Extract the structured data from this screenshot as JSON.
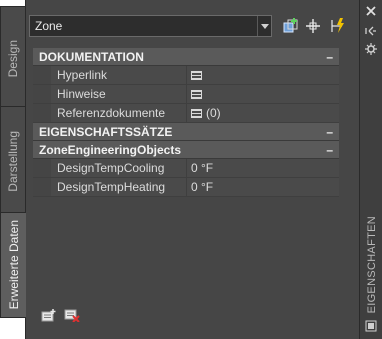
{
  "left_tabs": [
    "Design",
    "Darstellung",
    "Erweiterte Daten"
  ],
  "palette_title": "EIGENSCHAFTEN",
  "selector": {
    "value": "Zone"
  },
  "categories": [
    {
      "title": "DOKUMENTATION",
      "toggle": "–",
      "rows": [
        {
          "name": "Hyperlink",
          "value": ""
        },
        {
          "name": "Hinweise",
          "value": ""
        },
        {
          "name": "Referenzdokumente",
          "value": "(0)"
        }
      ]
    },
    {
      "title": "EIGENSCHAFTSSÄTZE",
      "toggle": "–"
    },
    {
      "title": "ZoneEngineeringObjects",
      "toggle": "–",
      "rows": [
        {
          "name": "DesignTempCooling",
          "value": "0 °F"
        },
        {
          "name": "DesignTempHeating",
          "value": "0 °F"
        }
      ]
    }
  ],
  "icons": {
    "close": "close-icon",
    "pin": "autohide-icon",
    "settings": "palette-properties-icon",
    "select_objects": "select-objects-icon",
    "pickadd": "pickadd-icon",
    "quick_select": "quick-select-icon",
    "add_property_sets": "add-property-sets-icon",
    "remove_property_sets": "remove-property-sets-icon"
  },
  "colors": {
    "panel": "#464646",
    "category": "#5a5a5a",
    "text": "#e0e0e0"
  }
}
